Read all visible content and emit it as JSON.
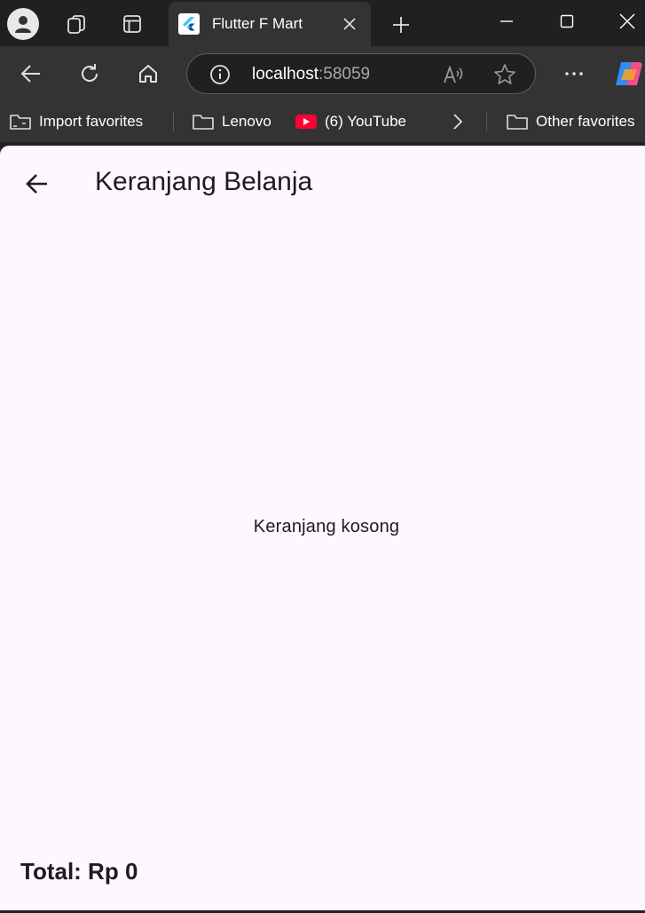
{
  "browser": {
    "tab": {
      "title": "Flutter F Mart"
    },
    "address": {
      "host": "localhost",
      "port": ":58059"
    },
    "favorites": [
      {
        "label": "Import favorites"
      },
      {
        "label": "Lenovo"
      },
      {
        "label": "(6) YouTube"
      },
      {
        "label": "Other favorites"
      }
    ]
  },
  "app": {
    "title": "Keranjang Belanja",
    "empty_message": "Keranjang kosong",
    "total_label": "Total: Rp 0"
  },
  "colors": {
    "page_background": "#fdf7fe",
    "chrome_dark": "#202020",
    "chrome_toolbar": "#333333",
    "text_primary": "#1d1b20"
  }
}
